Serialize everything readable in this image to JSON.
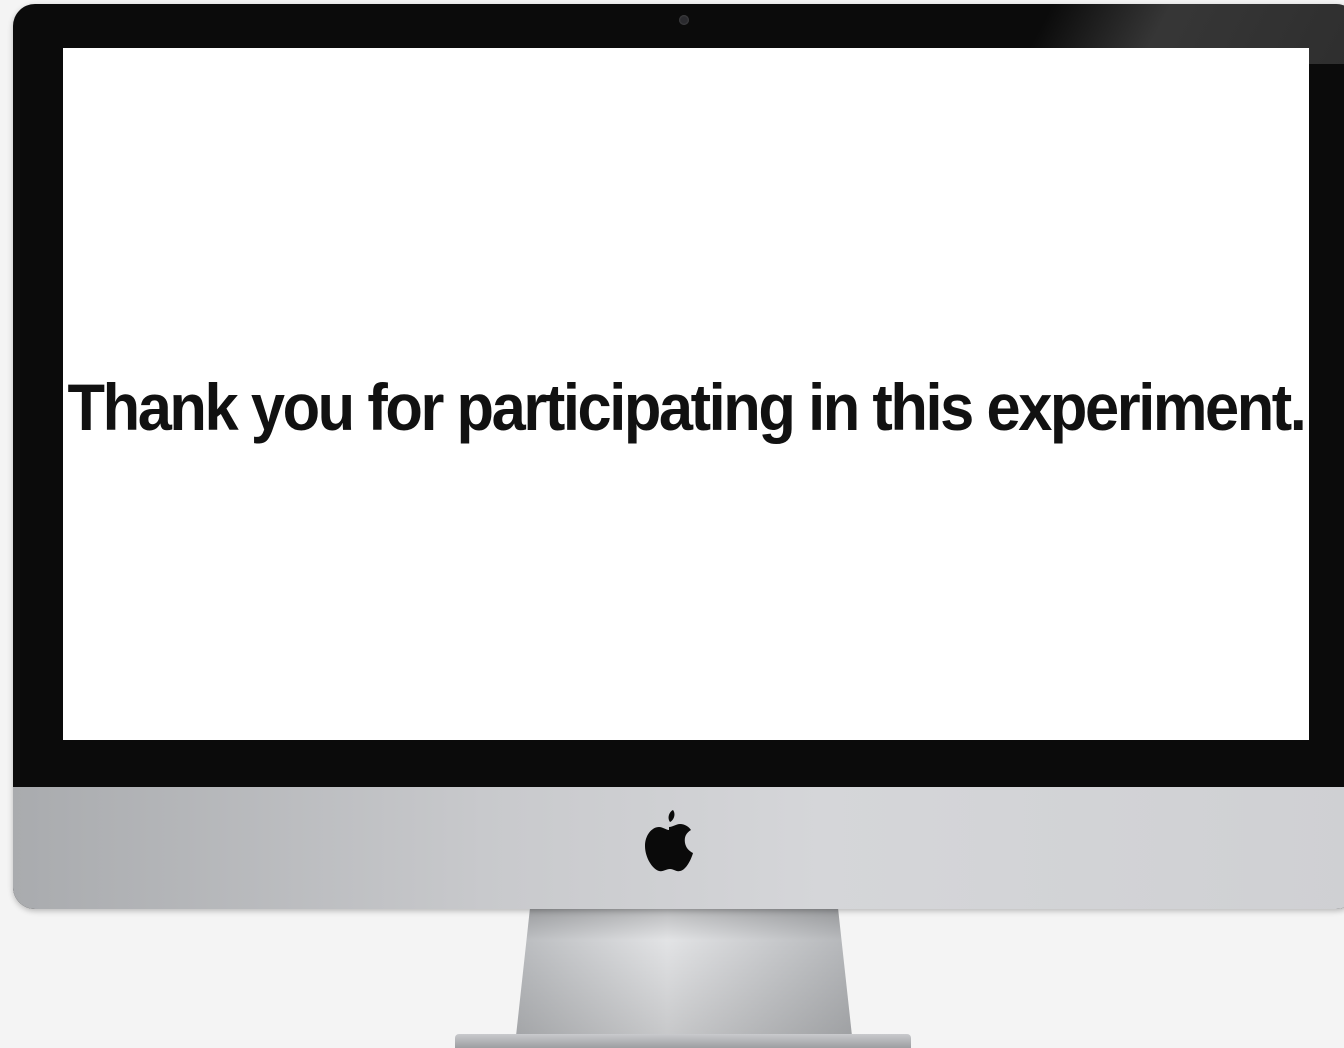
{
  "screen": {
    "message": "Thank you for participating in this experiment."
  },
  "device": {
    "logo_icon": "apple-logo-icon",
    "bezel_color": "#0b0b0b",
    "screen_color": "#ffffff",
    "text_color": "#111111"
  }
}
